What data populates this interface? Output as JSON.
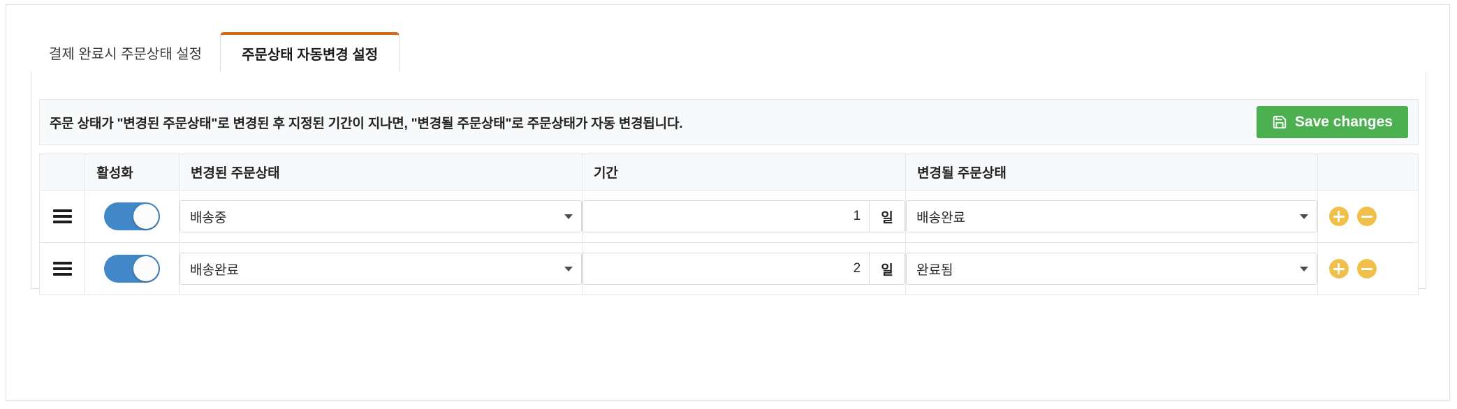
{
  "tabs": [
    {
      "label": "결제 완료시 주문상태 설정",
      "active": false
    },
    {
      "label": "주문상태 자동변경 설정",
      "active": true
    }
  ],
  "info": {
    "text": "주문 상태가 \"변경된 주문상태\"로 변경된 후 지정된 기간이 지나면, \"변경될 주문상태\"로 주문상태가 자동 변경됩니다.",
    "save_label": "Save changes",
    "save_icon": "save-floppy-icon"
  },
  "table": {
    "headers": {
      "handle": "",
      "enable": "활성화",
      "from_status": "변경된 주문상태",
      "period": "기간",
      "to_status": "변경될 주문상태",
      "actions": ""
    },
    "rows": [
      {
        "handle_icon": "drag-handle-icon",
        "enabled": true,
        "from_status": "배송중",
        "period_value": "1",
        "period_unit": "일",
        "to_status": "배송완료",
        "add_icon": "plus-circle-icon",
        "remove_icon": "minus-circle-icon"
      },
      {
        "handle_icon": "drag-handle-icon",
        "enabled": true,
        "from_status": "배송완료",
        "period_value": "2",
        "period_unit": "일",
        "to_status": "완료됨",
        "add_icon": "plus-circle-icon",
        "remove_icon": "minus-circle-icon"
      }
    ]
  },
  "colors": {
    "tab_accent": "#d2691e",
    "save_green": "#4caf50",
    "toggle_on": "#4287c8",
    "action_amber": "#f0c04a",
    "header_bg": "#f7f9fa",
    "border": "#e4e7ea"
  }
}
